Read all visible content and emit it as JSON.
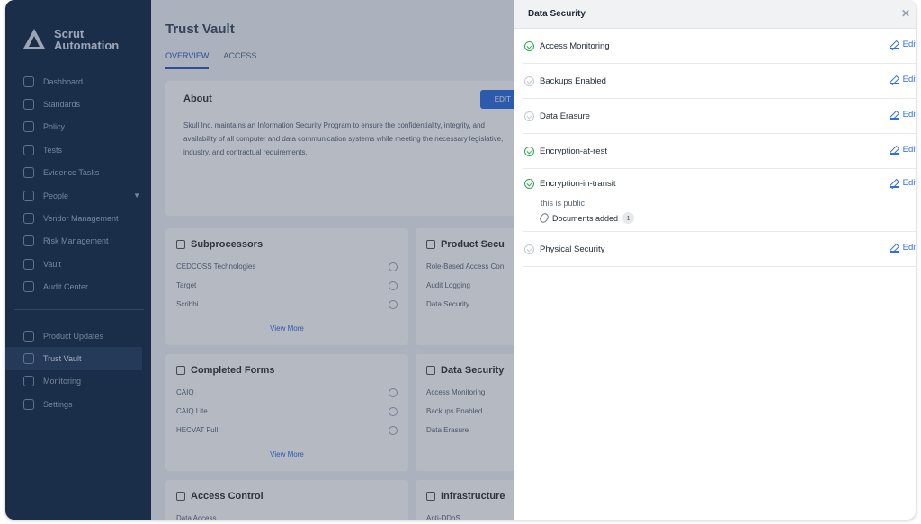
{
  "sidebar": {
    "logo_line1": "Scrut",
    "logo_line2": "Automation",
    "items": [
      {
        "label": "Dashboard",
        "icon": "dashboard-icon"
      },
      {
        "label": "Standards",
        "icon": "standards-icon"
      },
      {
        "label": "Policy",
        "icon": "policy-icon"
      },
      {
        "label": "Tests",
        "icon": "tests-icon"
      },
      {
        "label": "Evidence Tasks",
        "icon": "evidence-icon"
      },
      {
        "label": "People",
        "icon": "people-icon"
      },
      {
        "label": "Vendor Management",
        "icon": "vendor-icon"
      },
      {
        "label": "Risk Management",
        "icon": "risk-icon"
      },
      {
        "label": "Vault",
        "icon": "vault-icon"
      },
      {
        "label": "Audit Center",
        "icon": "audit-icon"
      }
    ],
    "bottom_items": [
      {
        "label": "Product Updates",
        "icon": "megaphone-icon"
      },
      {
        "label": "Trust Vault",
        "icon": "flag-icon"
      },
      {
        "label": "Monitoring",
        "icon": "chart-icon"
      },
      {
        "label": "Settings",
        "icon": "gear-icon"
      }
    ]
  },
  "main": {
    "title": "Trust Vault",
    "tabs": [
      "OVERVIEW",
      "ACCESS"
    ],
    "about": {
      "heading": "About",
      "edit": "EDIT",
      "text": "Skull Inc. maintains an Information Security Program to ensure the confidentiality, integrity, and availability of all computer and data communication systems while meeting the necessary legislative, industry, and contractual requirements."
    },
    "subprocessors": {
      "heading": "Subprocessors",
      "rows": [
        "CEDCOSS Technologies",
        "Target",
        "Scribbi"
      ],
      "more": "View More"
    },
    "product_security": {
      "heading": "Product Secu",
      "rows": [
        "Role-Based Access Con",
        "Audit Logging",
        "Data Security"
      ]
    },
    "completed_forms": {
      "heading": "Completed Forms",
      "rows": [
        "CAIQ",
        "CAIQ Lite",
        "HECVAT Full"
      ],
      "more": "View More"
    },
    "data_security_card": {
      "heading": "Data Security",
      "rows": [
        "Access Monitoring",
        "Backups Enabled",
        "Data Erasure"
      ]
    },
    "access_control": {
      "heading": "Access Control",
      "row": "Data Access"
    },
    "infrastructure": {
      "heading": "Infrastructure",
      "row": "Anti-DDoS"
    }
  },
  "drawer": {
    "title": "Data Security",
    "edit_label": "Edit",
    "items": [
      {
        "label": "Access Monitoring",
        "status": "enabled"
      },
      {
        "label": "Backups Enabled",
        "status": "disabled"
      },
      {
        "label": "Data Erasure",
        "status": "disabled"
      },
      {
        "label": "Encryption-at-rest",
        "status": "enabled"
      },
      {
        "label": "Encryption-in-transit",
        "status": "enabled",
        "note": "this is public",
        "docs_label": "Documents added",
        "docs_count": "1"
      },
      {
        "label": "Physical Security",
        "status": "disabled"
      }
    ]
  },
  "colors": {
    "accent": "#2f6fe0",
    "success": "#2fa84f",
    "sidebar": "#132a48"
  }
}
